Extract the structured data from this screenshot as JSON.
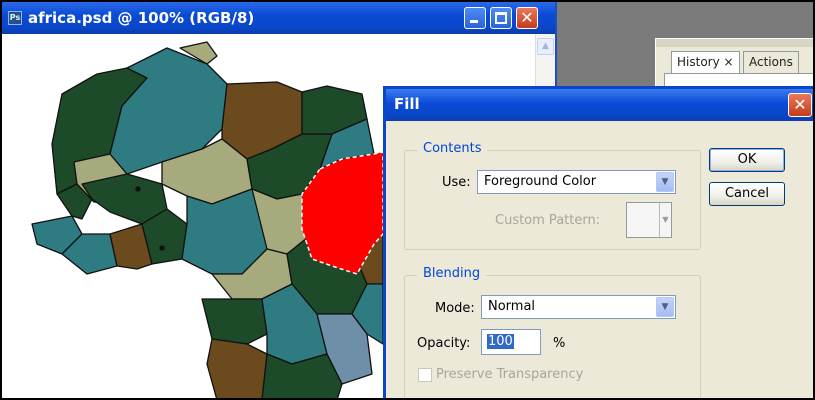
{
  "document": {
    "title": "africa.psd @ 100% (RGB/8)",
    "icon": "photoshop-document-icon",
    "icon_text": "Ps"
  },
  "colors": {
    "title_bar_blue": "#0a46c9",
    "selected_region_red": "#ff0000",
    "map_teal": "#2e7c82",
    "map_dark_green": "#1d4a28",
    "map_brown": "#6b4a1e",
    "map_sage": "#a6aa7c",
    "map_blue": "#6f8fa8",
    "workspace_gray": "#7b7b7b",
    "dialog_bg": "#ece9d8"
  },
  "panel": {
    "tabs": [
      "History ×",
      "Actions"
    ]
  },
  "dialog": {
    "title": "Fill",
    "contents": {
      "legend": "Contents",
      "use_label": "Use:",
      "use_value": "Foreground Color",
      "custom_pattern_label": "Custom Pattern:"
    },
    "blending": {
      "legend": "Blending",
      "mode_label": "Mode:",
      "mode_value": "Normal",
      "opacity_label": "Opacity:",
      "opacity_value": "100",
      "opacity_unit": "%",
      "preserve_label": "Preserve Transparency"
    },
    "ok_label": "OK",
    "cancel_label": "Cancel"
  }
}
